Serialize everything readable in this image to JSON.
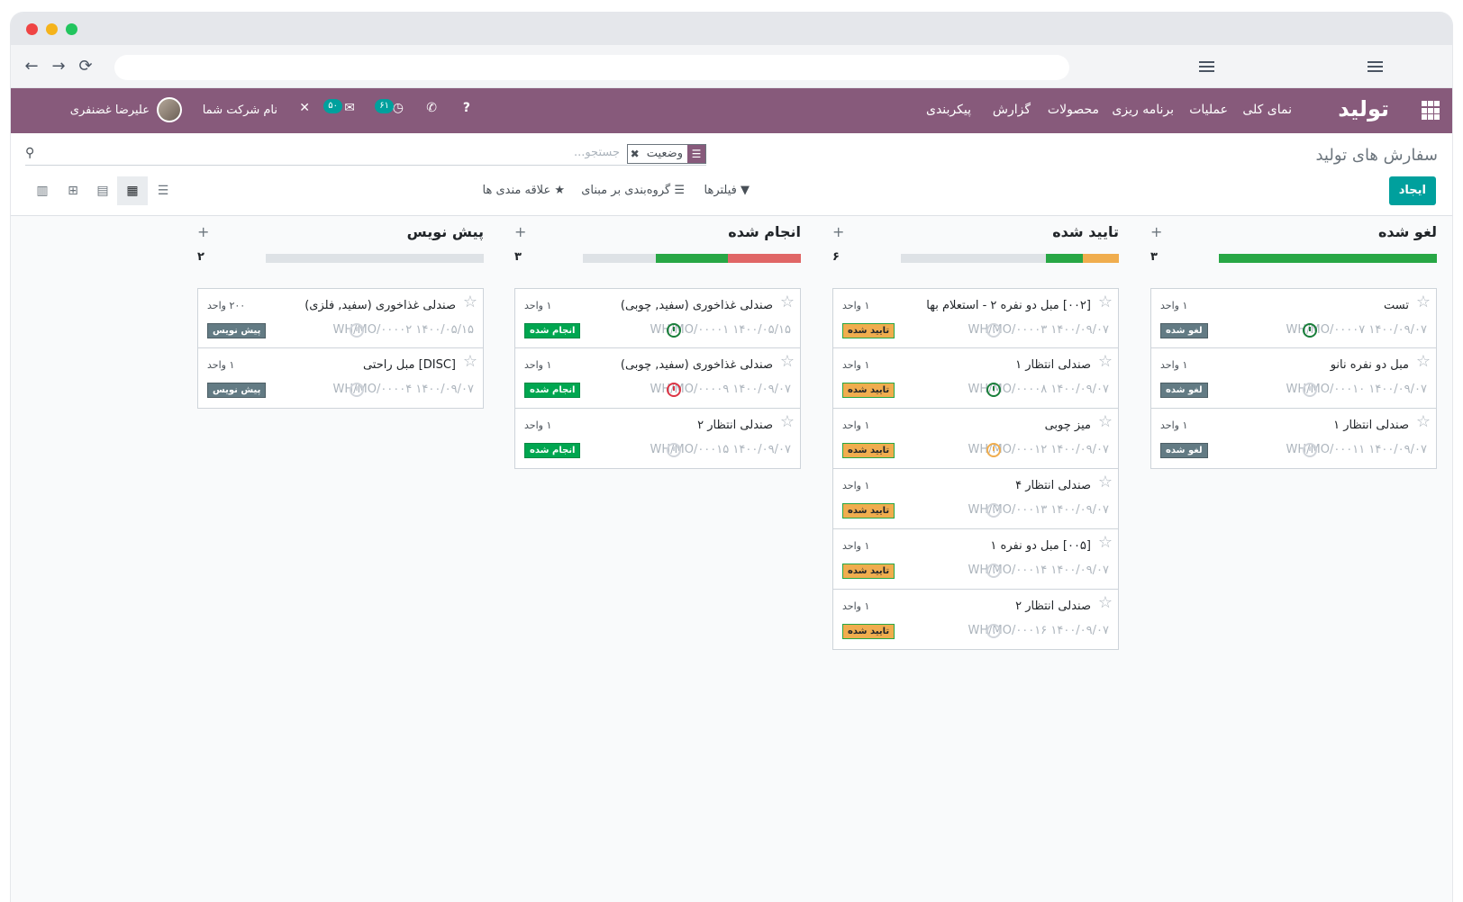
{
  "browser": {
    "back": "←",
    "forward": "→",
    "reload": "⟳"
  },
  "appbar": {
    "brand": "تولید",
    "menu": [
      "نمای کلی",
      "عملیات",
      "برنامه ریزی",
      "محصولات",
      "گزارش",
      "پیکربندی"
    ],
    "company": "نام شرکت شما",
    "user": "علیرضا غضنفری",
    "chat_badge": "۵۰",
    "activity_badge": "۶۱"
  },
  "control": {
    "title": "سفارش های تولید",
    "create": "ایجاد",
    "facet_label": "وضعیت",
    "search_placeholder": "جستجو...",
    "filters": "فیلترها",
    "groupby": "گروه‌بندی بر مبنای",
    "favorites": "علاقه مندی ها"
  },
  "columns": [
    {
      "title": "لغو شده",
      "count": "۳",
      "bar": [
        {
          "color": "#28a745",
          "value": 3
        }
      ],
      "cards": [
        {
          "title": "تست",
          "qty": "۱ واحد",
          "ref": "WH/MO/۰۰۰۰۷ ۱۴۰۰/۰۹/۰۷",
          "clock": "green",
          "tag": "لغو شده",
          "tagClass": "cancel"
        },
        {
          "title": "مبل دو نفره نانو",
          "qty": "۱ واحد",
          "ref": "WH/MO/۰۰۰۱۰ ۱۴۰۰/۰۹/۰۷",
          "clock": "grey",
          "tag": "لغو شده",
          "tagClass": "cancel"
        },
        {
          "title": "صندلی انتظار ۱",
          "qty": "۱ واحد",
          "ref": "WH/MO/۰۰۰۱۱ ۱۴۰۰/۰۹/۰۷",
          "clock": "grey",
          "tag": "لغو شده",
          "tagClass": "cancel"
        }
      ]
    },
    {
      "title": "تایید شده",
      "count": "۶",
      "bar": [
        {
          "color": "#28a745",
          "value": 1
        },
        {
          "color": "#f0ad4e",
          "value": 1
        }
      ],
      "cards": [
        {
          "title": "[۰۰۲] مبل دو نفره ۲ - استعلام بها",
          "qty": "۱ واحد",
          "ref": "WH/MO/۰۰۰۰۳ ۱۴۰۰/۰۹/۰۷",
          "clock": "grey",
          "tag": "تایید شده",
          "tagClass": "confirmed"
        },
        {
          "title": "صندلی انتظار ۱",
          "qty": "۱ واحد",
          "ref": "WH/MO/۰۰۰۰۸ ۱۴۰۰/۰۹/۰۷",
          "clock": "green",
          "tag": "تایید شده",
          "tagClass": "confirmed"
        },
        {
          "title": "میز چوبی",
          "qty": "۱ واحد",
          "ref": "WH/MO/۰۰۰۱۲ ۱۴۰۰/۰۹/۰۷",
          "clock": "orange",
          "tag": "تایید شده",
          "tagClass": "confirmed"
        },
        {
          "title": "صندلی انتظار ۴",
          "qty": "۱ واحد",
          "ref": "WH/MO/۰۰۰۱۳ ۱۴۰۰/۰۹/۰۷",
          "clock": "grey",
          "tag": "تایید شده",
          "tagClass": "confirmed"
        },
        {
          "title": "[۰۰۵] مبل دو نفره ۱",
          "qty": "۱ واحد",
          "ref": "WH/MO/۰۰۰۱۴ ۱۴۰۰/۰۹/۰۷",
          "clock": "grey",
          "tag": "تایید شده",
          "tagClass": "confirmed"
        },
        {
          "title": "صندلی انتظار ۲",
          "qty": "۱ واحد",
          "ref": "WH/MO/۰۰۰۱۶ ۱۴۰۰/۰۹/۰۷",
          "clock": "grey",
          "tag": "تایید شده",
          "tagClass": "confirmed"
        }
      ]
    },
    {
      "title": "انجام شده",
      "count": "۳",
      "bar": [
        {
          "color": "#28a745",
          "value": 1
        },
        {
          "color": "#e06666",
          "value": 1
        }
      ],
      "cards": [
        {
          "title": "صندلی غذاخوری (سفید, چوبی)",
          "qty": "۱ واحد",
          "ref": "WH/MO/۰۰۰۰۱ ۱۴۰۰/۰۵/۱۵",
          "clock": "green",
          "tag": "انجام شده",
          "tagClass": "done"
        },
        {
          "title": "صندلی غذاخوری (سفید, چوبی)",
          "qty": "۱ واحد",
          "ref": "WH/MO/۰۰۰۰۹ ۱۴۰۰/۰۹/۰۷",
          "clock": "red",
          "tag": "انجام شده",
          "tagClass": "done"
        },
        {
          "title": "صندلی انتظار ۲",
          "qty": "۱ واحد",
          "ref": "WH/MO/۰۰۰۱۵ ۱۴۰۰/۰۹/۰۷",
          "clock": "grey",
          "tag": "انجام شده",
          "tagClass": "done"
        }
      ]
    },
    {
      "title": "پیش نویس",
      "count": "۲",
      "bar": [],
      "cards": [
        {
          "title": "صندلی غذاخوری (سفید, فلزی)",
          "qty": "۲۰۰ واحد",
          "ref": "WH/MO/۰۰۰۰۲ ۱۴۰۰/۰۵/۱۵",
          "clock": "grey",
          "tag": "پیش نویس",
          "tagClass": "draft"
        },
        {
          "title": "[DISC] مبل راحتی",
          "qty": "۱ واحد",
          "ref": "WH/MO/۰۰۰۰۴ ۱۴۰۰/۰۹/۰۷",
          "clock": "grey",
          "tag": "پیش نویس",
          "tagClass": "draft"
        }
      ]
    }
  ]
}
